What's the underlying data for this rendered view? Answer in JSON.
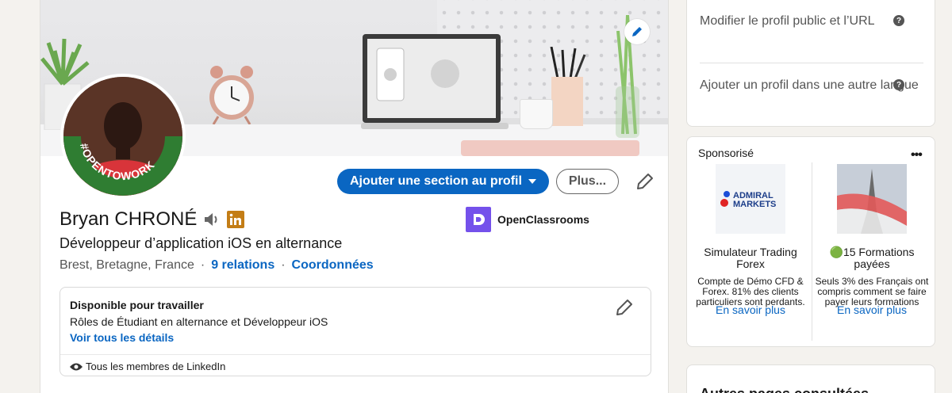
{
  "profile": {
    "name": "Bryan CHRONÉ",
    "headline": "Développeur d’application iOS en alternance",
    "location": "Brest, Bretagne, France",
    "separator": "·",
    "relations": "9 relations",
    "contact": "Coordonnées",
    "company": "OpenClassrooms",
    "otw_badge": "#OPENTOWORK"
  },
  "actions": {
    "add_section": "Ajouter une section au profil",
    "more": "Plus..."
  },
  "open_to_work": {
    "title": "Disponible pour travailler",
    "description": "Rôles de Étudiant en alternance et Développeur iOS",
    "link": "Voir tous les détails",
    "visibility": "Tous les membres de LinkedIn"
  },
  "sidebar": {
    "public_profile": "Modifier le profil public et l’URL",
    "other_language": "Ajouter un profil dans une autre langue",
    "help_glyph": "?"
  },
  "sponsored": {
    "title": "Sponsorisé",
    "more_glyph": "•••",
    "ads": [
      {
        "brand_line1": "ADMIRAL",
        "brand_line2": "MARKETS",
        "title": "Simulateur Trading Forex",
        "description": "Compte de Démo CFD & Forex. 81% des clients particuliers sont perdants.",
        "link": "En savoir plus"
      },
      {
        "title": "🟢15 Formations payées",
        "description": "Seuls 3% des Français ont compris comment se faire payer leurs formations",
        "link": "En savoir plus"
      }
    ]
  },
  "other_pages": {
    "title": "Autres pages consultées"
  },
  "colors": {
    "accent": "#0a66c2",
    "otw_green": "#2f7d32",
    "linkedin_badge": "#c37d16",
    "openclassrooms": "#7451eb"
  }
}
